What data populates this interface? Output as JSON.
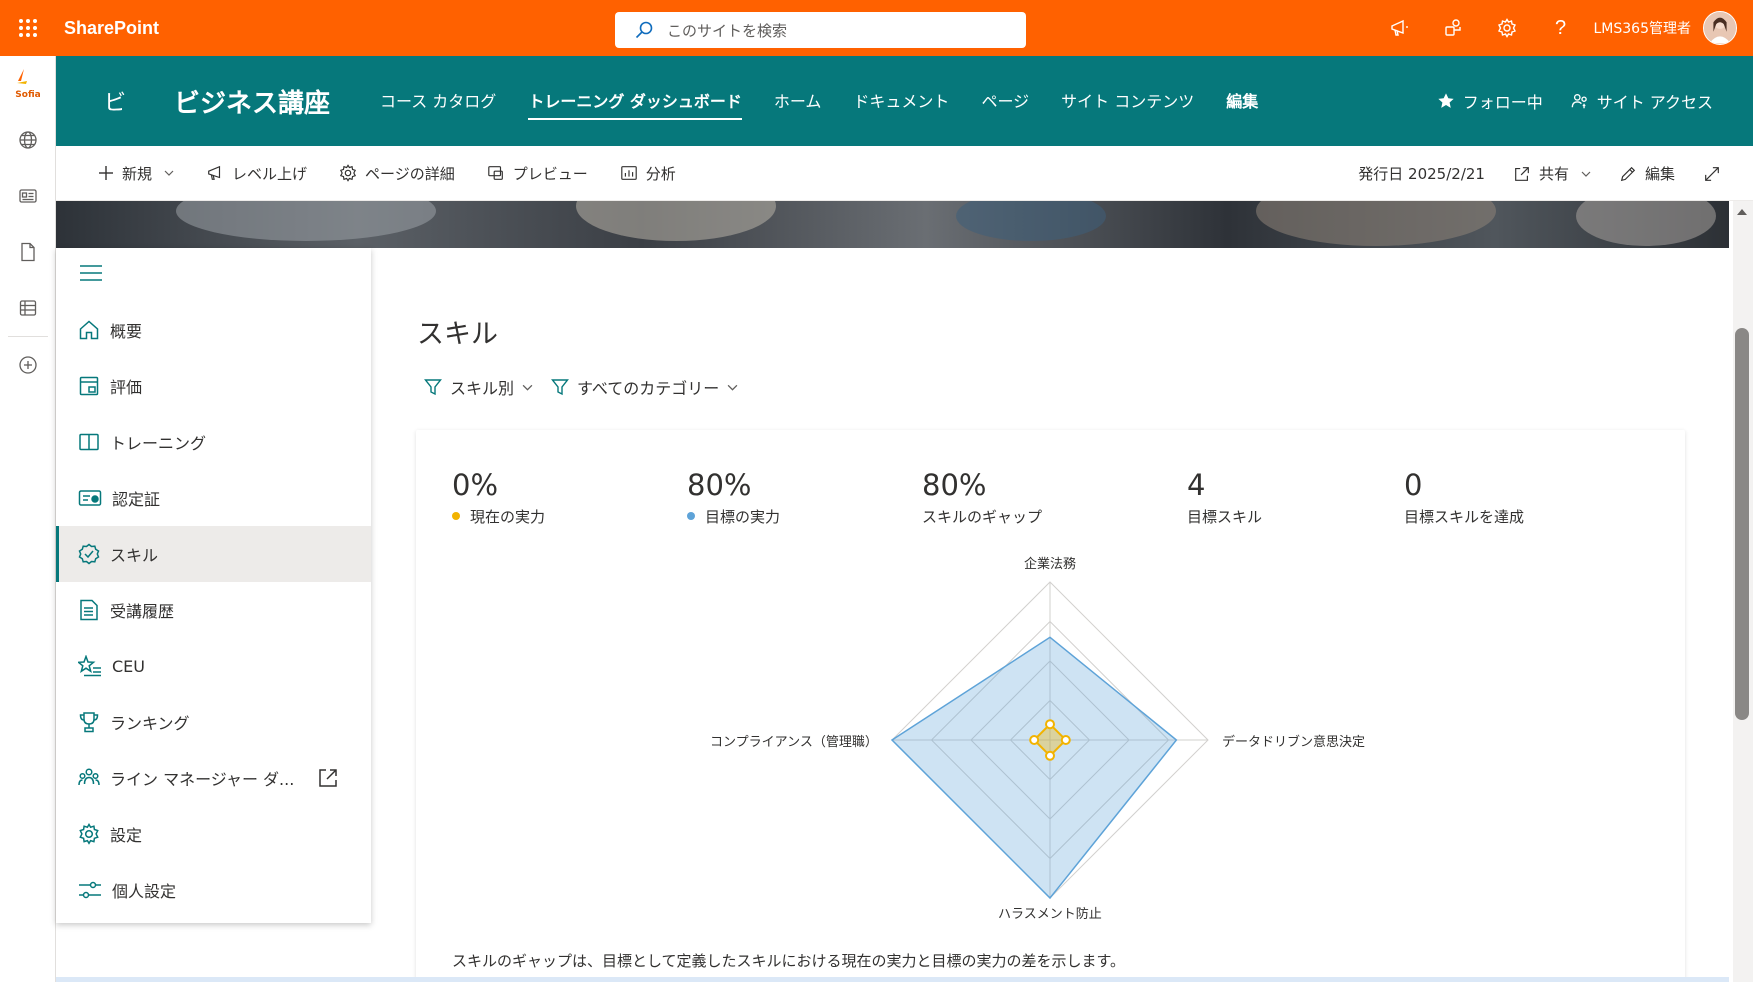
{
  "topbar": {
    "brand": "SharePoint",
    "search_placeholder": "このサイトを検索",
    "user_name": "LMS365管理者"
  },
  "left_rail": {
    "logo_text": "Sofia"
  },
  "site": {
    "logo_letter": "ビ",
    "title": "ビジネス講座",
    "nav": [
      {
        "label": "コース カタログ",
        "active": false
      },
      {
        "label": "トレーニング ダッシュボード",
        "active": true
      },
      {
        "label": "ホーム",
        "active": false
      },
      {
        "label": "ドキュメント",
        "active": false
      },
      {
        "label": "ページ",
        "active": false
      },
      {
        "label": "サイト コンテンツ",
        "active": false
      },
      {
        "label": "編集",
        "active": false
      }
    ],
    "follow_label": "フォロー中",
    "access_label": "サイト アクセス"
  },
  "commandbar": {
    "new_label": "新規",
    "promote_label": "レベル上げ",
    "details_label": "ページの詳細",
    "preview_label": "プレビュー",
    "analytics_label": "分析",
    "published_label": "発行日 2025/2/21",
    "share_label": "共有",
    "edit_label": "編集"
  },
  "sidenav": {
    "items": [
      {
        "label": "概要",
        "icon": "home-icon"
      },
      {
        "label": "評価",
        "icon": "assessment-icon"
      },
      {
        "label": "トレーニング",
        "icon": "book-icon"
      },
      {
        "label": "認定証",
        "icon": "certificate-icon"
      },
      {
        "label": "スキル",
        "icon": "skill-badge-icon",
        "active": true
      },
      {
        "label": "受講履歴",
        "icon": "transcript-icon"
      },
      {
        "label": "CEU",
        "icon": "star-list-icon"
      },
      {
        "label": "ランキング",
        "icon": "trophy-icon"
      },
      {
        "label": "ライン マネージャー ダ...",
        "icon": "people-icon",
        "external": true
      },
      {
        "label": "設定",
        "icon": "gear-icon"
      },
      {
        "label": "個人設定",
        "icon": "sliders-icon"
      }
    ]
  },
  "main": {
    "title": "スキル",
    "filter_by_skill": "スキル別",
    "filter_category": "すべてのカテゴリー",
    "stats": [
      {
        "value": "0%",
        "label": "現在の実力",
        "dot": "#f2b300"
      },
      {
        "value": "80%",
        "label": "目標の実力",
        "dot": "#5ea3d8"
      },
      {
        "value": "80%",
        "label": "スキルのギャップ"
      },
      {
        "value": "4",
        "label": "目標スキル"
      },
      {
        "value": "0",
        "label": "目標スキルを達成"
      }
    ],
    "footnote": "スキルのギャップは、目標として定義したスキルにおける現在の実力と目標の実力の差を示します。"
  },
  "chart_data": {
    "type": "radar",
    "categories": [
      "企業法務",
      "データドリブン意思決定",
      "ハラスメント防止",
      "コンプライアンス（管理職）"
    ],
    "max": 100,
    "series": [
      {
        "name": "目標の実力",
        "values": [
          65,
          80,
          100,
          100
        ],
        "color": "#5ea3d8"
      },
      {
        "name": "現在の実力",
        "values": [
          10,
          10,
          10,
          10
        ],
        "color": "#f2b300"
      }
    ]
  },
  "colors": {
    "suite_bar": "#ff6100",
    "site_header": "#06787b",
    "accent": "#06787b"
  }
}
